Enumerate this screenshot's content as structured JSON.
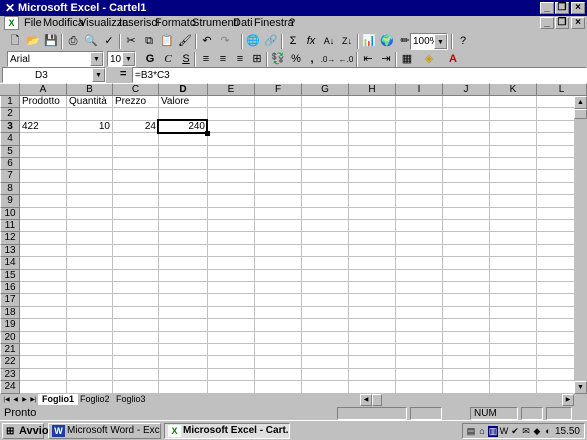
{
  "window": {
    "title": "Microsoft Excel - Cartel1"
  },
  "menu": [
    "File",
    "Modifica",
    "Visualizza",
    "Inserisci",
    "Formato",
    "Strumenti",
    "Dati",
    "Finestra",
    "?"
  ],
  "toolbar": {
    "zoom": "100%"
  },
  "format_toolbar": {
    "font": "Arial",
    "size": "10",
    "bold": "G",
    "italic": "C",
    "underline": "S",
    "percent": "%",
    "comma": ","
  },
  "formula_bar": {
    "cell_ref": "D3",
    "equals": "=",
    "formula": "=B3*C3"
  },
  "columns": [
    "A",
    "B",
    "C",
    "D",
    "E",
    "F",
    "G",
    "H",
    "I",
    "J",
    "K",
    "L"
  ],
  "rows": [
    "1",
    "2",
    "3",
    "4",
    "5",
    "6",
    "7",
    "8",
    "9",
    "10",
    "11",
    "12",
    "13",
    "14",
    "15",
    "16",
    "17",
    "18",
    "19",
    "20",
    "21",
    "22",
    "23",
    "24"
  ],
  "cells": {
    "A1": "Prodotto",
    "B1": "Quantità",
    "C1": "Prezzo",
    "D1": "Valore",
    "A3": "422",
    "B3": "10",
    "C3": "24",
    "D3": "240"
  },
  "active_cell": "D3",
  "sheets": [
    "Foglio1",
    "Foglio2",
    "Foglio3"
  ],
  "active_sheet": "Foglio1",
  "status": {
    "text": "Pronto",
    "num": "NUM"
  },
  "taskbar": {
    "start": "Avvio",
    "tasks": [
      "Microsoft Word - Excel.doc",
      "Microsoft Excel - Cart..."
    ],
    "clock": "15.50"
  }
}
